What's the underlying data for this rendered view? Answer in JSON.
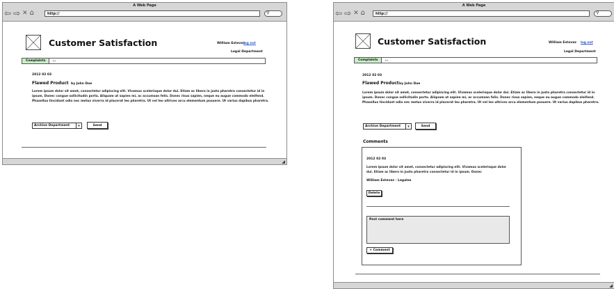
{
  "window_title": "A Web Page",
  "browser": {
    "url": "http://"
  },
  "app": {
    "title": "Customer Satisfaction",
    "user_name": "William Estevez",
    "logout_label": "log out",
    "department": "Legal Department"
  },
  "tabs": {
    "active": "Complaints",
    "more": "..."
  },
  "post": {
    "date": "2012 02 03",
    "title": "Flawed Product",
    "byline": "by John Doe",
    "body": "Lorem ipsum dolor sit amet, consectetur adipiscing elit. Vivamus scelerisque dolor dui. Etiam ac libero in justo pharetra consectetur id in ipsum. Donec congue sollicitudin porta. Aliquam ut sapien mi, ac accumsan felis. Donec risus sapien, neque eu augue commodo eleifend. Phasellus tincidunt odio nec metus viverra id placerat leo pharetra. Ut vel leo ultrices arcu elementum posuere. Ut varius dapibus pharetra."
  },
  "actions": {
    "archive_select": "Archive Department",
    "send_label": "Send"
  },
  "comments": {
    "heading": "Comments",
    "date": "2012 02 03",
    "text": "Lorem ipsum dolor sit amet, consectetur adipiscing elit. Vivamus scelerisque dolor dui. Etiam ac libero in justo pharetra consectetur id in ipsum. Donec",
    "author": "William Estevez - Legales",
    "delete_label": "Delete",
    "input_placeholder": "Post comment here",
    "add_label": "+ Comment"
  },
  "icons": {
    "back": "back-arrow-icon",
    "forward": "forward-arrow-icon",
    "close": "close-icon",
    "home": "home-icon",
    "search": "search-icon",
    "logo": "image-placeholder-icon",
    "resize": "resize-grip-icon"
  },
  "colors": {
    "active_tab": "#c9eec8",
    "logout_link": "#2a5ad0",
    "chrome": "#d6d6d6"
  }
}
